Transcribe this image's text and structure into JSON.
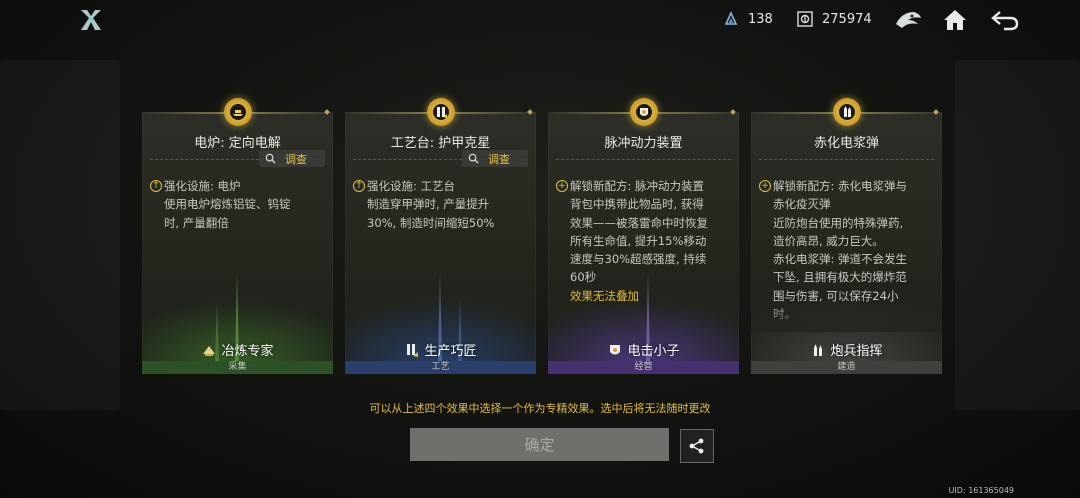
{
  "topbar": {
    "logo_icon": "game-logo-icon",
    "stat1_icon": "crystal-icon",
    "stat1_value": "138",
    "stat2_icon": "credit-icon",
    "stat2_value": "275974",
    "nav_icons": [
      "faction-emblem-icon",
      "home-icon",
      "back-icon"
    ]
  },
  "cards": [
    {
      "title": "电炉: 定向电解",
      "investigate": "调查",
      "lines": [
        {
          "marker": "upgrade",
          "text": "强化设施: 电炉"
        },
        {
          "marker": "",
          "text": "使用电炉熔炼铝锭、钨锭"
        },
        {
          "marker": "",
          "text": "时, 产量翻倍"
        }
      ],
      "effect_note": "",
      "specialist": "冶炼专家",
      "category": "采集",
      "accent": "#3b6b2a"
    },
    {
      "title": "工艺台: 护甲克星",
      "investigate": "调查",
      "lines": [
        {
          "marker": "upgrade",
          "text": "强化设施: 工艺台"
        },
        {
          "marker": "",
          "text": "制造穿甲弹时, 产量提升"
        },
        {
          "marker": "",
          "text": "30%, 制造时间缩短50%"
        }
      ],
      "effect_note": "",
      "specialist": "生产巧匠",
      "category": "工艺",
      "accent": "#2f4f8a"
    },
    {
      "title": "脉冲动力装置",
      "investigate": "",
      "lines": [
        {
          "marker": "unlock",
          "text": "解锁新配方: 脉冲动力装置"
        },
        {
          "marker": "",
          "text": "背包中携带此物品时, 获得"
        },
        {
          "marker": "",
          "text": "效果——被落雷命中时恢复"
        },
        {
          "marker": "",
          "text": "所有生命值, 提升15%移动"
        },
        {
          "marker": "",
          "text": "速度与30%超感强度, 持续"
        },
        {
          "marker": "",
          "text": "60秒"
        }
      ],
      "effect_note": "效果无法叠加",
      "specialist": "电击小子",
      "category": "经营",
      "accent": "#5a3f8f"
    },
    {
      "title": "赤化电浆弹",
      "investigate": "",
      "lines": [
        {
          "marker": "unlock",
          "text": "解锁新配方: 赤化电浆弹与"
        },
        {
          "marker": "",
          "text": "赤化疫灭弹"
        },
        {
          "marker": "",
          "text": "近防炮台使用的特殊弹药,"
        },
        {
          "marker": "",
          "text": "造价高昂, 威力巨大。"
        },
        {
          "marker": "",
          "text": "赤化电浆弹: 弹道不会发生"
        },
        {
          "marker": "",
          "text": "下坠, 且拥有极大的爆炸范"
        },
        {
          "marker": "",
          "text": "围与伤害, 可以保存24小"
        },
        {
          "marker": "",
          "text": "时。"
        }
      ],
      "effect_note": "",
      "specialist": "炮兵指挥",
      "category": "建造",
      "accent": "#4a4a4a"
    }
  ],
  "hint": "可以从上述四个效果中选择一个作为专精效果。选中后将无法随时更改",
  "confirm_label": "确定",
  "share_icon": "share-icon",
  "uid": "UID: 161365049"
}
